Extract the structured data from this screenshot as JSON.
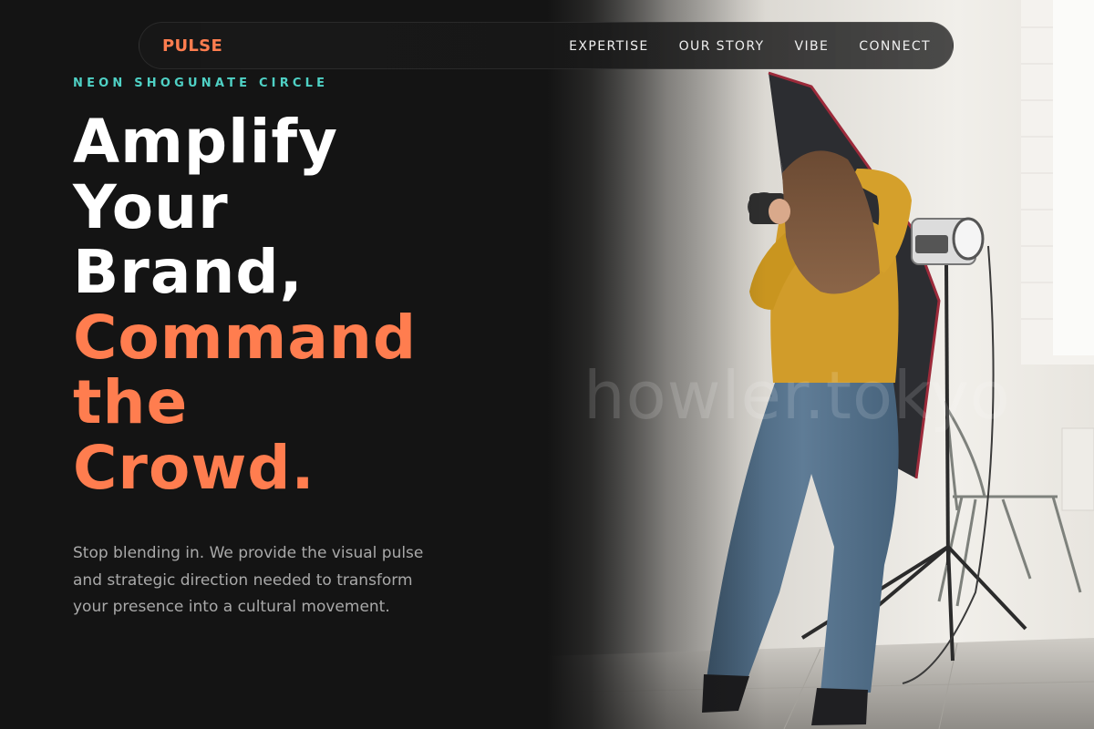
{
  "brand": {
    "name": "PULSE",
    "accent_color": "#ff7d4f"
  },
  "nav": {
    "items": [
      {
        "label": "EXPERTISE"
      },
      {
        "label": "OUR STORY"
      },
      {
        "label": "VIBE"
      },
      {
        "label": "CONNECT"
      }
    ]
  },
  "hero": {
    "eyebrow": "NEON SHOGUNATE CIRCLE",
    "eyebrow_color": "#4fd1c5",
    "headline_lines": [
      "Amplify",
      "Your",
      "Brand,"
    ],
    "headline_accent_lines": [
      "Command",
      "the",
      "Crowd."
    ],
    "subcopy_lines": [
      "Stop blending in. We provide the visual pulse",
      "and strategic direction needed to transform",
      "your presence into a cultural movement."
    ],
    "image": {
      "subject": "photographer-in-studio",
      "watermark": "howler.tokyo"
    }
  },
  "colors": {
    "background": "#141414",
    "text": "#ffffff",
    "muted_text": "#a9a9a9"
  }
}
